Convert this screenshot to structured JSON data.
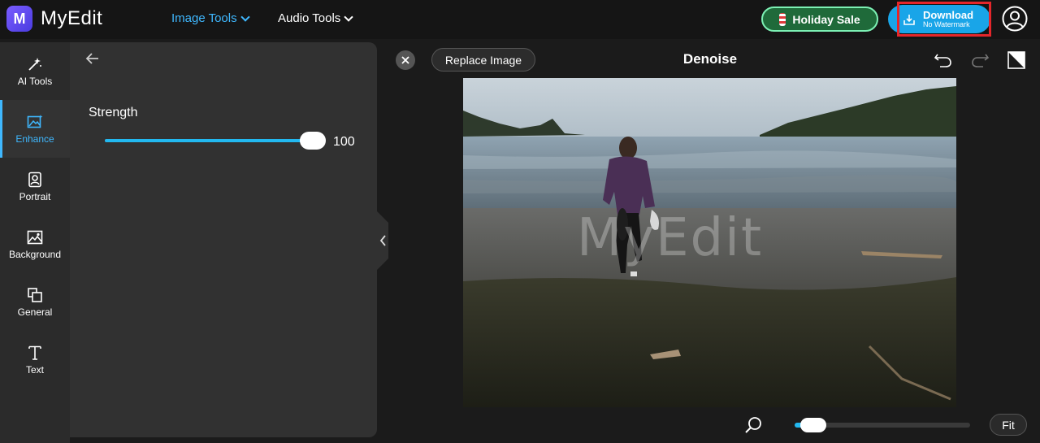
{
  "app": {
    "name": "MyEdit",
    "logo_letter": "M"
  },
  "nav": {
    "image_tools": "Image Tools",
    "audio_tools": "Audio Tools"
  },
  "header": {
    "holiday_sale": "Holiday Sale",
    "download": {
      "main": "Download",
      "sub": "No Watermark"
    }
  },
  "sidebar": {
    "items": [
      {
        "label": "AI Tools",
        "icon": "magic-wand-icon",
        "active": false
      },
      {
        "label": "Enhance",
        "icon": "enhance-image-icon",
        "active": true
      },
      {
        "label": "Portrait",
        "icon": "portrait-icon",
        "active": false
      },
      {
        "label": "Background",
        "icon": "background-icon",
        "active": false
      },
      {
        "label": "General",
        "icon": "layers-icon",
        "active": false
      },
      {
        "label": "Text",
        "icon": "text-icon",
        "active": false
      }
    ]
  },
  "panel": {
    "strength_label": "Strength",
    "strength_value": "100",
    "strength_fraction": 1.0
  },
  "canvas": {
    "replace_label": "Replace Image",
    "title": "Denoise",
    "watermark": "MyEdit",
    "fit_label": "Fit",
    "zoom_fraction": 0.05
  },
  "colors": {
    "accent": "#22b8f0",
    "active_nav": "#3fb8ff",
    "download_bg": "#19a5e8",
    "holiday_border": "#7cf0b4",
    "highlight": "#e5262a"
  }
}
